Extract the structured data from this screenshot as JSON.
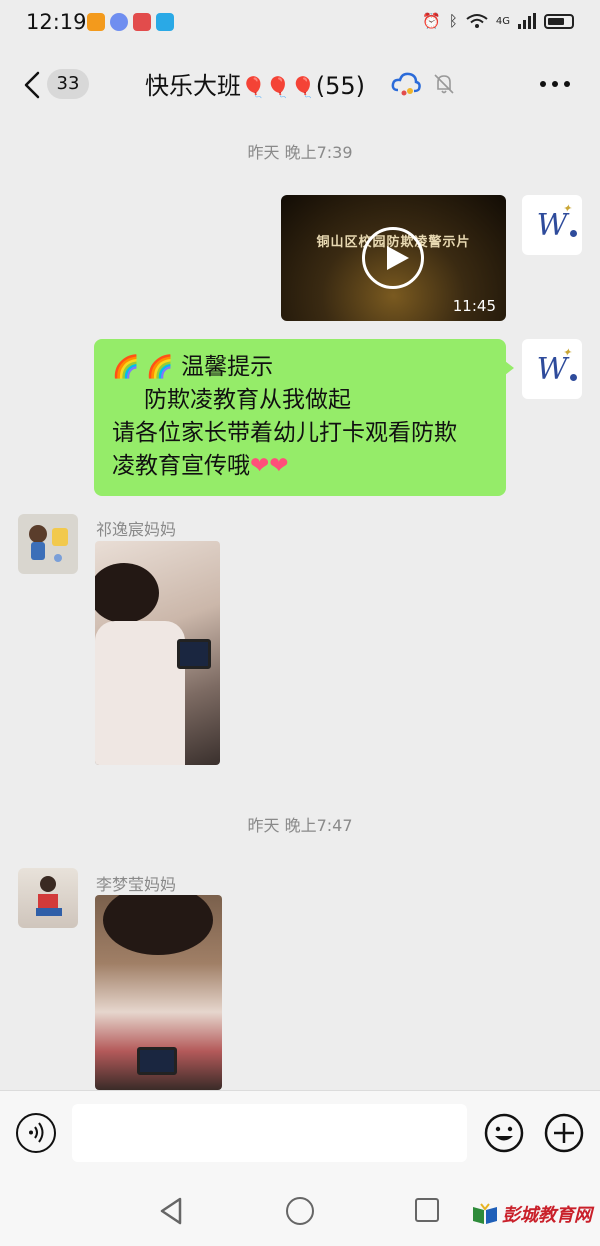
{
  "status_bar": {
    "time": "12:19",
    "network": "4G",
    "app_icon_colors": [
      "#f39a1c",
      "#6f8ef0",
      "#e24c4c",
      "#2aa9e6"
    ]
  },
  "header": {
    "unread_count": "33",
    "title": "快乐大班",
    "title_decoration": "🎈🎈🎈",
    "member_count": "(55)"
  },
  "messages": [
    {
      "type": "timestamp",
      "text": "昨天 晚上7:39"
    },
    {
      "type": "video",
      "side": "right",
      "sender_avatar": "w-logo",
      "video_title": "铜山区校园防欺凌警示片",
      "duration": "11:45"
    },
    {
      "type": "text",
      "side": "right",
      "sender_avatar": "w-logo",
      "lines": {
        "line1_emoji": "🌈 🌈",
        "line1_text": "温馨提示",
        "line2": "防欺凌教育从我做起",
        "line3": "请各位家长带着幼儿打卡观看防欺",
        "line4": "凌教育宣传哦",
        "line4_emoji": "❤❤"
      }
    },
    {
      "type": "image",
      "side": "left",
      "sender_name": "祁逸宸妈妈"
    },
    {
      "type": "timestamp",
      "text": "昨天 晚上7:47"
    },
    {
      "type": "image",
      "side": "left",
      "sender_name": "李梦莹妈妈"
    }
  ],
  "watermark": {
    "text": "彭城教育网"
  },
  "colors": {
    "chat_background": "#ededed",
    "sent_bubble": "#95ec69",
    "timestamp_text": "#8a8a8a"
  }
}
